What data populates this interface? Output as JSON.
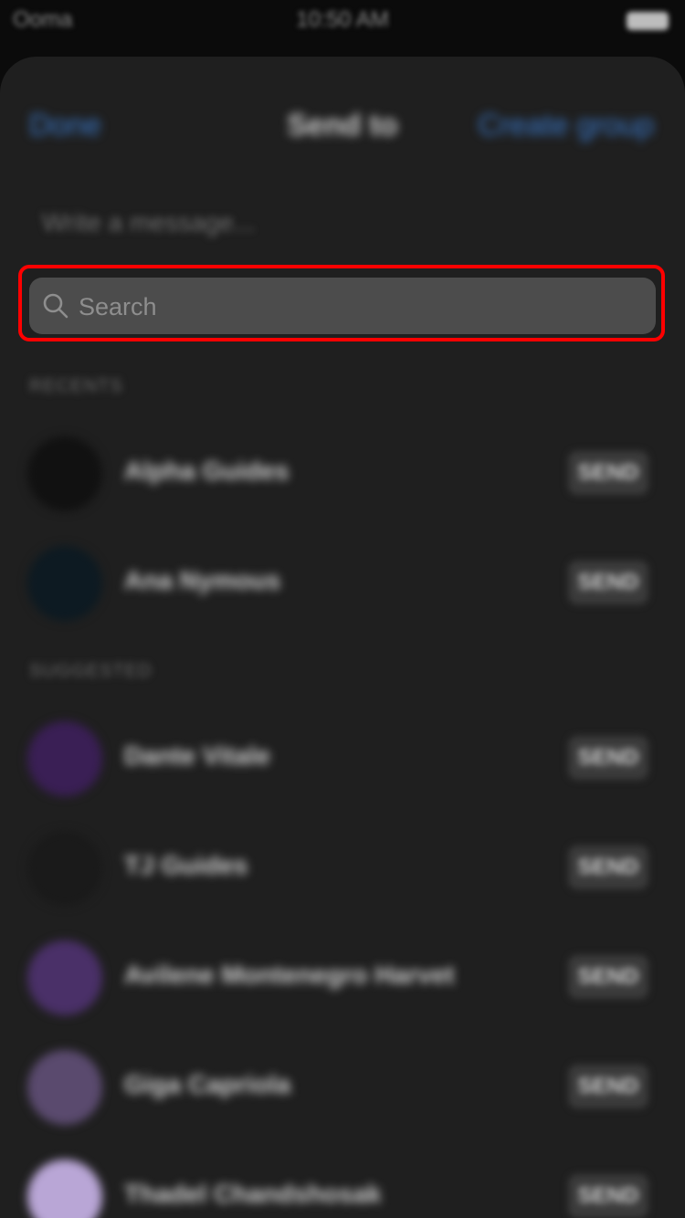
{
  "status_bar": {
    "carrier": "Ooma",
    "time": "10:50 AM"
  },
  "header": {
    "done_label": "Done",
    "title": "Send to",
    "create_group_label": "Create group"
  },
  "message": {
    "placeholder": "Write a message..."
  },
  "search": {
    "placeholder": "Search"
  },
  "sections": {
    "recents": "RECENTS",
    "suggested": "SUGGESTED"
  },
  "send_label": "SEND",
  "recents": [
    {
      "name": "Alpha Guides",
      "avatar_color": "#111111"
    },
    {
      "name": "Ana Nymous",
      "avatar_color": "#0d1a22"
    }
  ],
  "suggested": [
    {
      "name": "Dante Vitale",
      "avatar_color": "#3a1f55"
    },
    {
      "name": "TJ Guides",
      "avatar_color": "#1a1a1a"
    },
    {
      "name": "Avilene Montenegro Harvet",
      "avatar_color": "#4a3068"
    },
    {
      "name": "Giga Capriola",
      "avatar_color": "#5a4a6e"
    },
    {
      "name": "Thadel Chandshosak",
      "avatar_color": "#b9a6d6"
    }
  ]
}
